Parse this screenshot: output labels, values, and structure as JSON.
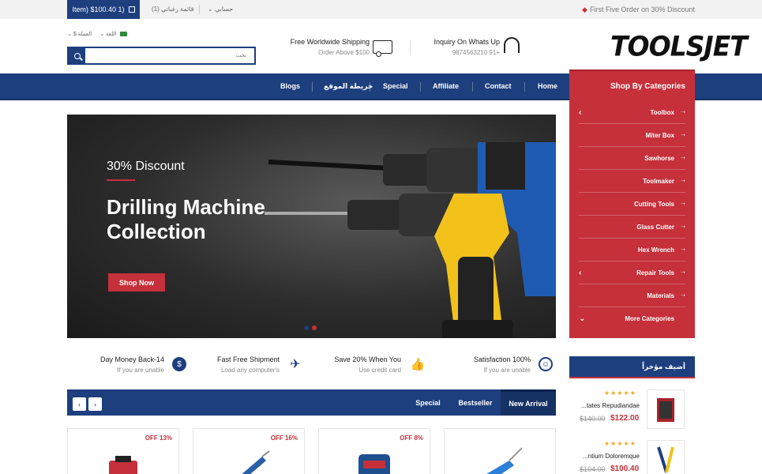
{
  "topbar": {
    "cart": "Item) $100.40 1)",
    "wishlist": "قائمة رغباتي (1)",
    "account": "حسابي",
    "promo": "First Five Order on 30% Discount"
  },
  "header": {
    "currency": "$ العملة",
    "language": "اللغة",
    "search_placeholder": "بحث",
    "shipping_title": "Free Worldwide Shipping",
    "shipping_sub": "Order Above $100",
    "inquiry_title": "Inquiry On Whats Up",
    "inquiry_sub": "9874563210 91+",
    "logo_a": "TOOLS",
    "logo_b": "JET"
  },
  "nav": {
    "items": [
      "Blogs",
      "خريطة الموقع",
      "Special",
      "Affiliate",
      "Contact",
      "Home"
    ]
  },
  "categories": {
    "title": "Shop By Categories",
    "items": [
      "Toolbox",
      "Miter Box",
      "Sawhorse",
      "Toolmaker",
      "Cutting Tools",
      "Glass Cutter",
      "Hex Wrench",
      "Repair Tools",
      "Materials",
      "More Categories"
    ]
  },
  "hero": {
    "discount": "30% Discount",
    "title": "Drilling Machine Collection",
    "button": "Shop Now"
  },
  "features": [
    {
      "title": "Day Money Back-14",
      "sub": "If you are unable",
      "icon": "money-bag-icon"
    },
    {
      "title": "Fast Free Shipment",
      "sub": "Load any computer's",
      "icon": "airplane-icon"
    },
    {
      "title": "Save 20% When You",
      "sub": "Use credit card",
      "icon": "thumbs-up-icon"
    },
    {
      "title": "Satisfaction 100%",
      "sub": "If you are unable",
      "icon": "smile-icon"
    }
  ],
  "tabs": {
    "prev": "‹",
    "next": "›",
    "items": [
      "Special",
      "Bestseller",
      "New Arrival"
    ],
    "active": "New Arrival"
  },
  "products": [
    {
      "off": "OFF 13%"
    },
    {
      "off": "OFF 16%"
    },
    {
      "off": "OFF 8%"
    },
    {
      "off": ""
    }
  ],
  "recent": {
    "title": "أضيف مؤخراً",
    "items": [
      {
        "stars": "★★★★★",
        "name": "...tates Repudiandae",
        "old": "$140.00",
        "new": "$122.00"
      },
      {
        "stars": "★★★★★",
        "name": "...ntium Doloremque",
        "old": "$104.00",
        "new": "$100.40"
      }
    ]
  },
  "colors": {
    "brand_blue": "#1d3f7e",
    "accent_red": "#c5303a"
  }
}
